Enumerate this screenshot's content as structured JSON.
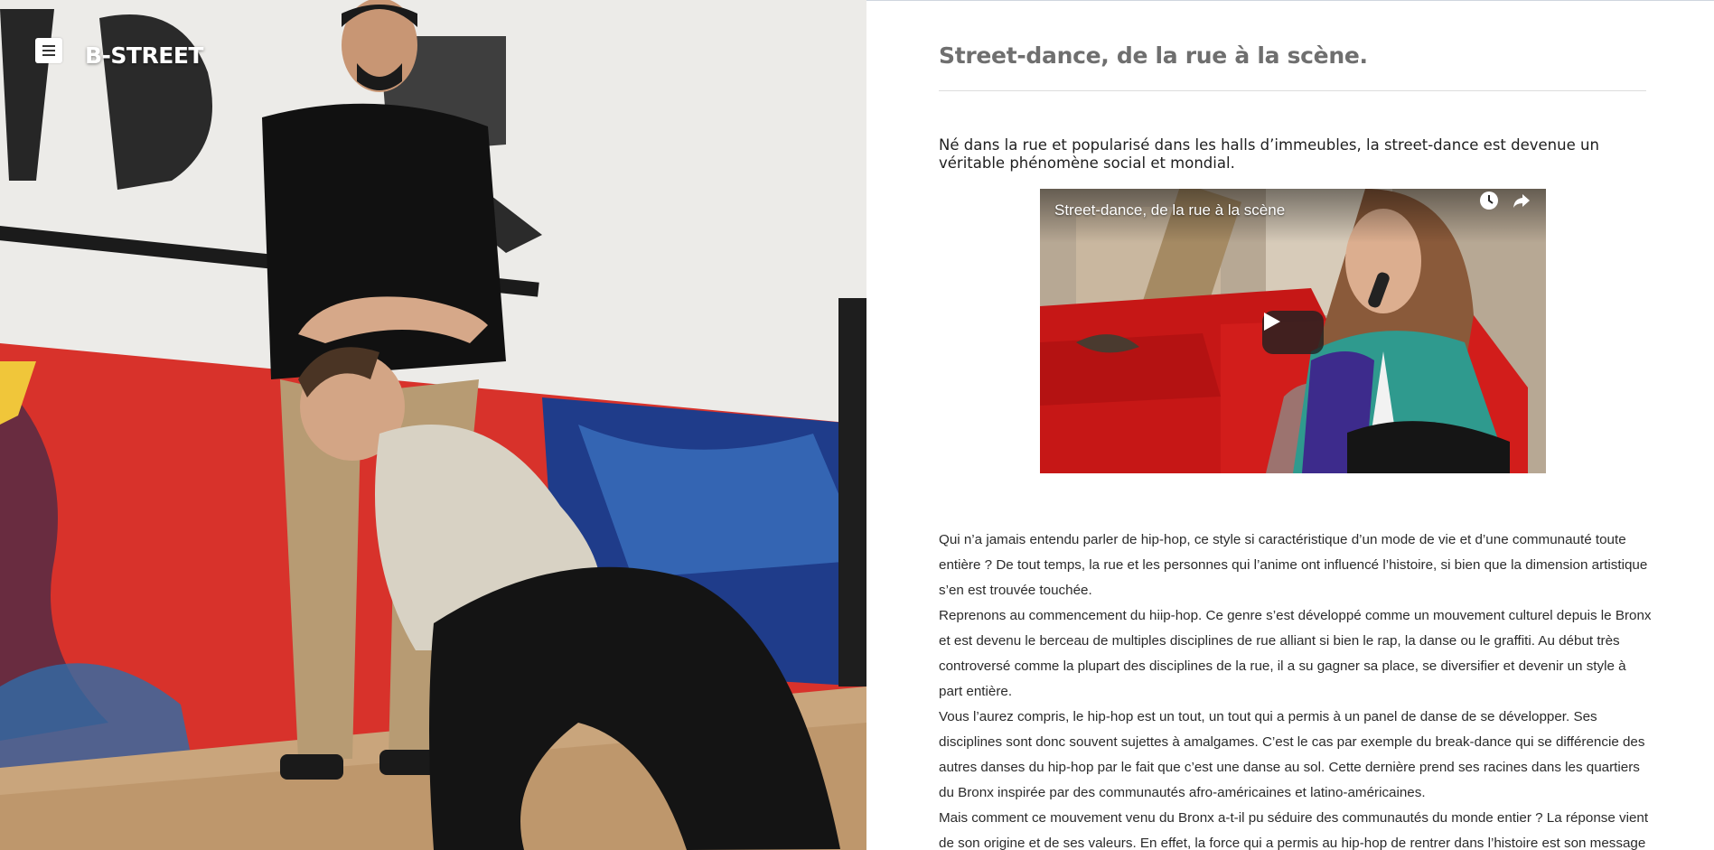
{
  "header": {
    "brand": "B-STREET",
    "menu_icon": "hamburger-menu-icon"
  },
  "article": {
    "title": "Street-dance, de la rue à la scène.",
    "lead": "Né dans la rue et popularisé dans les halls d’immeubles, la street-dance est devenue un véritable phénomène social et mondial."
  },
  "video": {
    "title": "Street-dance, de la rue à la scène",
    "icons": [
      "watch-later-icon",
      "share-icon",
      "play-icon"
    ]
  },
  "body": {
    "paragraphs": [
      "Qui n’a jamais entendu parler de hip-hop, ce style si caractéristique d’un mode de vie et d’une communauté toute entière ? De tout temps, la rue et les personnes qui l’anime ont influencé l’histoire, si bien que la dimension artistique s’en est trouvée touchée.",
      "Reprenons au commencement du hiip-hop. Ce genre s’est développé comme un mouvement culturel depuis le Bronx et est devenu le berceau de multiples disciplines de rue alliant si bien le rap, la danse ou le graffiti. Au début très controversé comme la plupart des disciplines de la rue, il a su gagner sa place, se diversifier et devenir un style à part entière.",
      "Vous l’aurez compris, le hip-hop est un tout, un tout qui a permis à un panel de danse de se développer. Ses disciplines sont donc souvent sujettes à amalgames. C’est le cas par exemple du break-dance qui se différencie des autres danses du hip-hop par le fait que c’est une danse au sol. Cette dernière prend ses racines dans les quartiers du Bronx inspirée par des communautés afro-américaines et latino-américaines.",
      "Mais comment ce mouvement venu du Bronx a-t-il pu séduire des communautés du monde entier ? La réponse vient de son origine et de ses valeurs. En effet, la force qui a permis au hip-hop de rentrer dans l’histoire est son message de"
    ]
  }
}
